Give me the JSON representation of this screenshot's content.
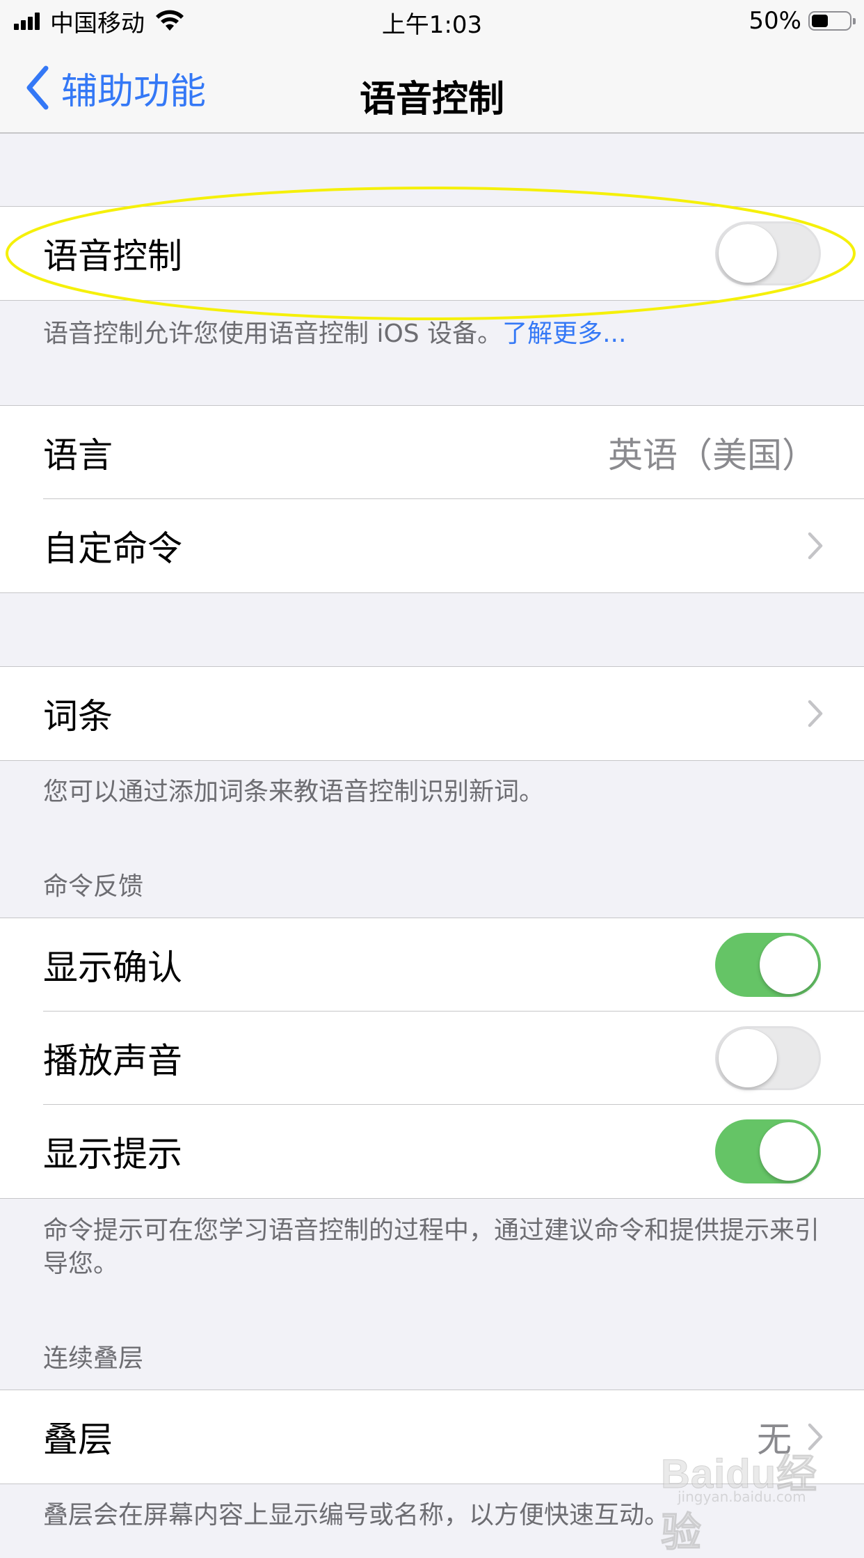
{
  "status_bar": {
    "carrier": "中国移动",
    "time": "上午1:03",
    "battery_percent": "50%",
    "battery_level": 0.5
  },
  "nav": {
    "back_label": "辅助功能",
    "title": "语音控制"
  },
  "voice_control": {
    "label": "语音控制",
    "enabled": false,
    "footer_text": "语音控制允许您使用语音控制 iOS 设备。",
    "footer_link": "了解更多..."
  },
  "language_group": {
    "language_label": "语言",
    "language_value": "英语（美国）",
    "custom_commands_label": "自定命令"
  },
  "vocabulary": {
    "label": "词条",
    "footer_text": "您可以通过添加词条来教语音控制识别新词。"
  },
  "command_feedback": {
    "header": "命令反馈",
    "show_confirmation_label": "显示确认",
    "show_confirmation_enabled": true,
    "play_sound_label": "播放声音",
    "play_sound_enabled": false,
    "show_hints_label": "显示提示",
    "show_hints_enabled": true,
    "footer_text": "命令提示可在您学习语音控制的过程中，通过建议命令和提供提示来引导您。"
  },
  "continuous_overlay": {
    "header": "连续叠层",
    "overlay_label": "叠层",
    "overlay_value": "无",
    "footer_text": "叠层会在屏幕内容上显示编号或名称，以方便快速互动。"
  },
  "watermark": {
    "brand": "Baidu经验",
    "url": "jingyan.baidu.com"
  },
  "colors": {
    "accent": "#3478f6",
    "toggle_on": "#65c466",
    "annotation": "#f5f00a"
  }
}
